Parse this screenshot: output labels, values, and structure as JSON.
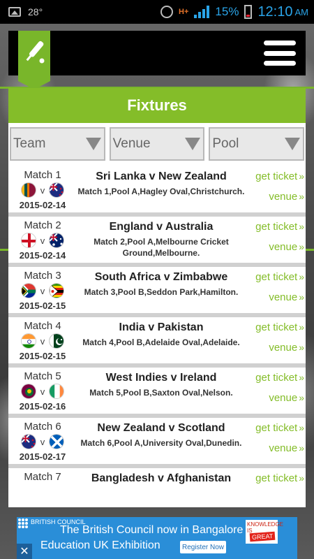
{
  "status_bar": {
    "temperature": "28°",
    "network": "H+",
    "battery_percent": "15%",
    "time": "12:10",
    "ampm": "AM"
  },
  "app_bar": {
    "logo_icon": "cricket-bat-icon",
    "menu_icon": "hamburger-menu-icon"
  },
  "fixtures": {
    "title": "Fixtures",
    "filters": [
      "Team",
      "Venue",
      "Pool"
    ],
    "get_ticket_label": "get ticket",
    "venue_label": "venue",
    "link_chevron": "»",
    "vs_label": "v",
    "matches": [
      {
        "label": "Match 1",
        "date": "2015-02-14",
        "title": "Sri Lanka v New Zealand",
        "desc": "Match 1,Pool A,Hagley Oval,Christchurch.",
        "flag1": "sri-lanka",
        "flag2": "new-zealand"
      },
      {
        "label": "Match 2",
        "date": "2015-02-14",
        "title": "England v Australia",
        "desc": "Match 2,Pool A,Melbourne Cricket Ground,Melbourne.",
        "flag1": "england",
        "flag2": "australia"
      },
      {
        "label": "Match 3",
        "date": "2015-02-15",
        "title": "South Africa v Zimbabwe",
        "desc": "Match 3,Pool B,Seddon Park,Hamilton.",
        "flag1": "south-africa",
        "flag2": "zimbabwe"
      },
      {
        "label": "Match 4",
        "date": "2015-02-15",
        "title": "India v Pakistan",
        "desc": "Match 4,Pool B,Adelaide Oval,Adelaide.",
        "flag1": "india",
        "flag2": "pakistan"
      },
      {
        "label": "Match 5",
        "date": "2015-02-16",
        "title": "West Indies v Ireland",
        "desc": "Match 5,Pool B,Saxton Oval,Nelson.",
        "flag1": "west-indies",
        "flag2": "ireland"
      },
      {
        "label": "Match 6",
        "date": "2015-02-17",
        "title": "New Zealand v Scotland",
        "desc": "Match 6,Pool A,University Oval,Dunedin.",
        "flag1": "new-zealand",
        "flag2": "scotland"
      },
      {
        "label": "Match 7",
        "date": "",
        "title": "Bangladesh v Afghanistan",
        "desc": "",
        "flag1": "bangladesh",
        "flag2": "afghanistan"
      }
    ]
  },
  "ad": {
    "brand": "BRITISH COUNCIL",
    "line1_a": "The British Council",
    "line1_b": "now in Bangalore",
    "line2": "Education UK Exhibition",
    "cta": "Register Now",
    "badge": "KNOWLEDGE IS",
    "badge_emph": "GREAT",
    "close": "✕"
  },
  "colors": {
    "accent": "#84bd29",
    "status_blue": "#2aa4e8",
    "ad_blue": "#2a8ed8"
  }
}
